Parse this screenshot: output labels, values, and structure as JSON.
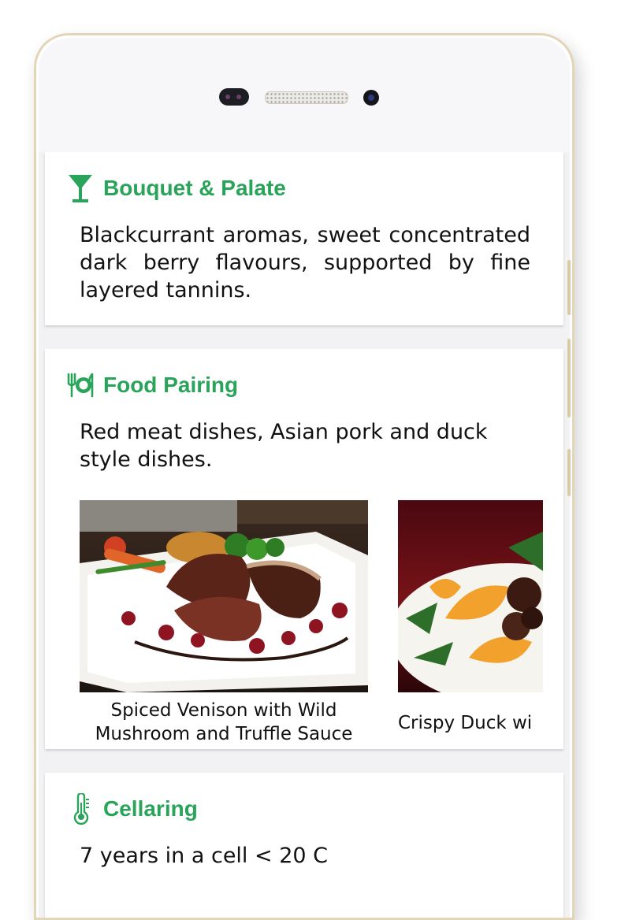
{
  "sections": [
    {
      "icon": "cocktail-glass-icon",
      "title": "Bouquet & Palate",
      "body": "Blackcurrant aromas, sweet concentrated dark berry flavours, supported by fine layered tannins."
    },
    {
      "icon": "plate-cutlery-icon",
      "title": "Food Pairing",
      "body": "Red meat dishes, Asian pork and duck style dishes.",
      "dishes": [
        {
          "caption_line1": "Spiced Venison with Wild",
          "caption_line2": "Mushroom and Truffle Sauce"
        },
        {
          "caption_line1": "Crispy Duck wi",
          "caption_line2": ""
        }
      ]
    },
    {
      "icon": "thermometer-icon",
      "title": "Cellaring",
      "body": "7 years in a cell < 20 C"
    }
  ],
  "colors": {
    "accent": "#2aa45a",
    "text": "#111111",
    "screen_background": "#f2f2f4",
    "phone_frame": "#e3d6b8"
  }
}
